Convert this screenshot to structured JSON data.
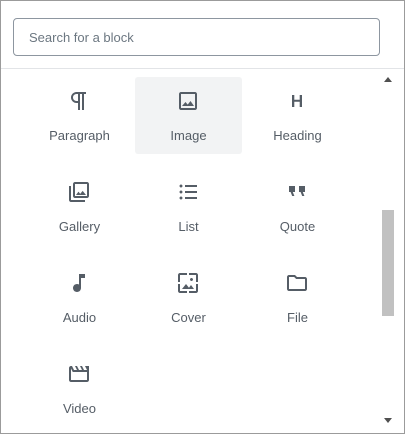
{
  "search": {
    "placeholder": "Search for a block",
    "value": ""
  },
  "blocks": [
    {
      "label": "Paragraph",
      "icon": "paragraph-icon",
      "active": false
    },
    {
      "label": "Image",
      "icon": "image-icon",
      "active": true
    },
    {
      "label": "Heading",
      "icon": "heading-icon",
      "active": false
    },
    {
      "label": "Gallery",
      "icon": "gallery-icon",
      "active": false
    },
    {
      "label": "List",
      "icon": "list-icon",
      "active": false
    },
    {
      "label": "Quote",
      "icon": "quote-icon",
      "active": false
    },
    {
      "label": "Audio",
      "icon": "audio-icon",
      "active": false
    },
    {
      "label": "Cover",
      "icon": "cover-icon",
      "active": false
    },
    {
      "label": "File",
      "icon": "file-icon",
      "active": false
    },
    {
      "label": "Video",
      "icon": "video-icon",
      "active": false
    }
  ],
  "colors": {
    "icon": "#555d66",
    "label": "#555d66",
    "active_background": "#f2f3f4",
    "input_border": "#8d96a0"
  }
}
